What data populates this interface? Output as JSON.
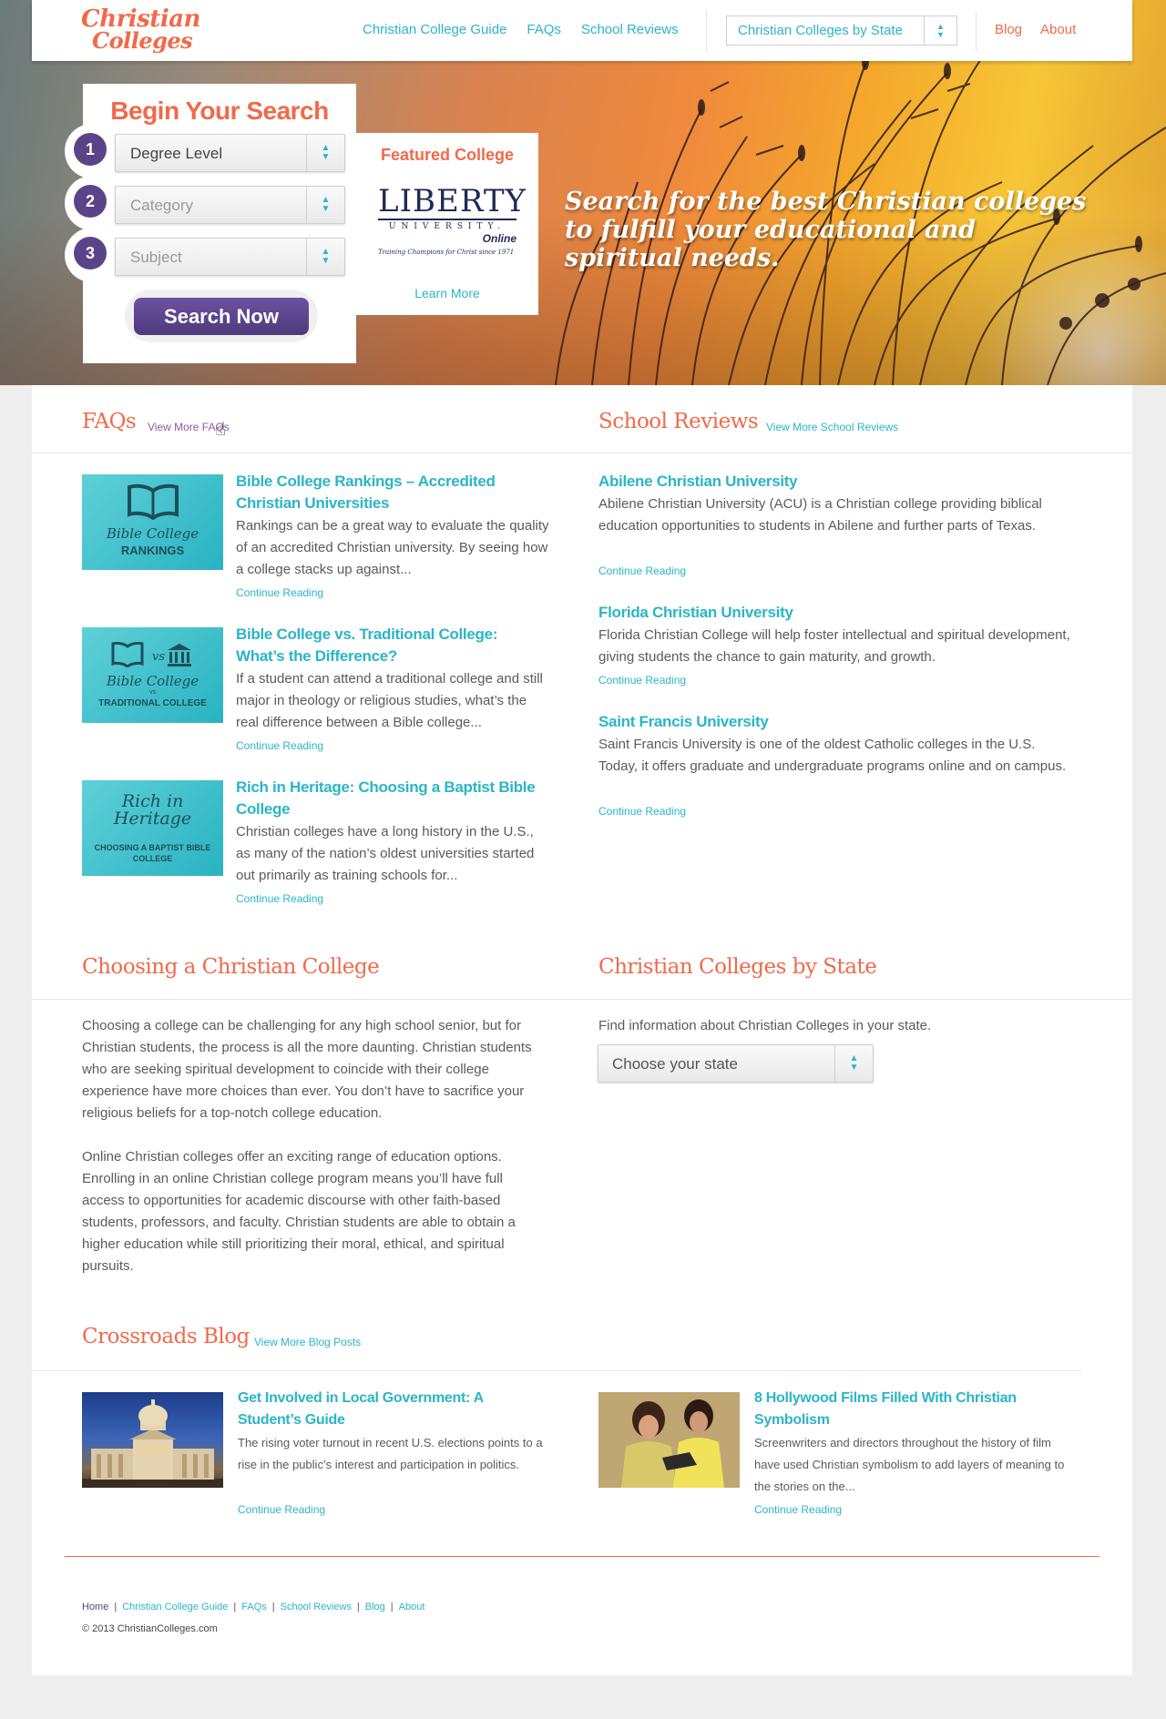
{
  "header": {
    "logo_line1": "Christian",
    "logo_line2": "Colleges",
    "nav": [
      "Christian College Guide",
      "FAQs",
      "School Reviews"
    ],
    "state_select_value": "Christian Colleges by State",
    "nav_right": [
      "Blog",
      "About"
    ]
  },
  "hero": {
    "tagline": "Search for the best Christian colleges to fulfill your educational and spiritual needs."
  },
  "search": {
    "title": "Begin Your Search",
    "steps": [
      {
        "num": "1",
        "value": "Degree Level"
      },
      {
        "num": "2",
        "value": "Category"
      },
      {
        "num": "3",
        "value": "Subject"
      }
    ],
    "button": "Search Now"
  },
  "featured": {
    "title": "Featured College",
    "logo_main": "LIBERTY",
    "logo_sub": "UNIVERSITY.",
    "logo_online": "Online",
    "logo_tagline": "Training Champions for Christ since 1971",
    "link": "Learn More"
  },
  "faqs": {
    "heading": "FAQs",
    "more": "View More FAQs",
    "items": [
      {
        "thumb_line1": "Bible College",
        "thumb_line2": "RANKINGS",
        "title": "Bible College Rankings – Accredited Christian Universities",
        "text": "Rankings can be a great way to evaluate the quality of an accredited Christian university. By seeing how a college stacks up against...",
        "link": "Continue Reading"
      },
      {
        "thumb_line1": "Bible College",
        "thumb_line2": "TRADITIONAL COLLEGE",
        "thumb_vs": "vs",
        "title": "Bible College vs. Traditional College: What’s the Difference?",
        "text": "If a student can attend a traditional college and still major in theology or religious studies, what’s the real difference between a Bible college...",
        "link": "Continue Reading"
      },
      {
        "thumb_line1": "Rich in Heritage",
        "thumb_line2": "CHOOSING A BAPTIST BIBLE COLLEGE",
        "title": "Rich in Heritage: Choosing a Baptist Bible College",
        "text": "Christian colleges have a long history in the U.S., as many of the nation’s oldest universities started out primarily as training schools for...",
        "link": "Continue Reading"
      }
    ]
  },
  "reviews": {
    "heading": "School Reviews",
    "more": "View More School Reviews",
    "items": [
      {
        "title": "Abilene Christian University",
        "text": "Abilene Christian University (ACU) is a Christian college providing biblical education opportunities to students in Abilene and further parts of Texas.",
        "link": "Continue Reading"
      },
      {
        "title": "Florida Christian University",
        "text": "Florida Christian College will help foster intellectual and spiritual development, giving students the chance to gain maturity, and growth.",
        "link": "Continue Reading"
      },
      {
        "title": "Saint Francis University",
        "text": "Saint Francis University is one of the oldest Catholic colleges in the U.S. Today, it offers graduate and undergraduate programs online and on campus.",
        "link": "Continue Reading"
      }
    ]
  },
  "choosing": {
    "heading": "Choosing a Christian College",
    "p1": "Choosing a college can be challenging for any high school senior, but for Christian students, the process is all the more daunting. Christian students who are seeking spiritual development to coincide with their college experience have more choices than ever. You don’t have to sacrifice your religious beliefs for a top-notch college education.",
    "p2": "Online Christian colleges offer an exciting range of education options. Enrolling in an online Christian college program means you’ll have full access to opportunities for academic discourse with other faith-based students, professors, and faculty. Christian students are able to obtain a higher education while still prioritizing their moral, ethical, and spiritual pursuits."
  },
  "by_state": {
    "heading": "Christian Colleges by State",
    "text": "Find information about Christian Colleges in your state.",
    "select": "Choose your state"
  },
  "blog": {
    "heading": "Crossroads Blog",
    "more": "View More Blog Posts",
    "items": [
      {
        "title": "Get Involved in Local Government: A Student’s Guide",
        "text": "The rising voter turnout in recent U.S. elections points to a rise in the public’s interest and participation in politics.",
        "link": "Continue Reading"
      },
      {
        "title": "8 Hollywood Films Filled With Christian Symbolism",
        "text": "Screenwriters and directors throughout the history of film have used Christian symbolism to add layers of meaning to the stories on the...",
        "link": "Continue Reading"
      }
    ]
  },
  "footer": {
    "links": [
      "Home",
      "Christian College Guide",
      "FAQs",
      "School Reviews",
      "Blog",
      "About"
    ],
    "copyright": "© 2013 ChristianColleges.com"
  },
  "colors": {
    "accent": "#f06a4a",
    "link": "#2bb5c6",
    "purple": "#5b4387"
  }
}
